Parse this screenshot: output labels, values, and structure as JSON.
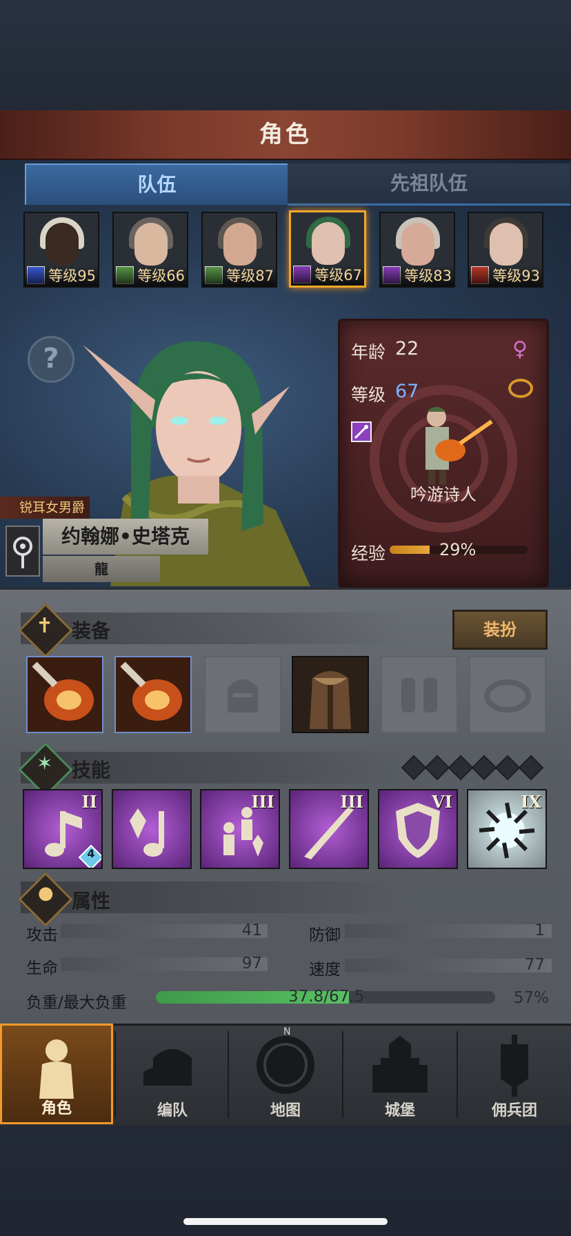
{
  "header": {
    "title": "角色"
  },
  "tabs": [
    {
      "label": "队伍",
      "active": true
    },
    {
      "label": "先祖队伍",
      "active": false
    }
  ],
  "roster": [
    {
      "level_text": "等级95",
      "class_color": "#3b5bdb",
      "skin": "#3a2a22",
      "hair": "#d9d4c8"
    },
    {
      "level_text": "等级66",
      "class_color": "#5a9a4a",
      "skin": "#d9b8a0",
      "hair": "#6a6460"
    },
    {
      "level_text": "等级87",
      "class_color": "#5a9a4a",
      "skin": "#d2a890",
      "hair": "#5e5650"
    },
    {
      "level_text": "等级67",
      "class_color": "#8c3fbf",
      "skin": "#e0c0b0",
      "hair": "#2f6a44",
      "selected": true
    },
    {
      "level_text": "等级83",
      "class_color": "#8c3fbf",
      "skin": "#d6aa98",
      "hair": "#c9c2b8"
    },
    {
      "level_text": "等级93",
      "class_color": "#c23a2a",
      "skin": "#dfc0ae",
      "hair": "#3e3a38"
    }
  ],
  "character": {
    "title": "锐耳女男爵",
    "name": "约翰娜•史塔克",
    "faction": "龍",
    "age_label": "年龄",
    "age": "22",
    "level_label": "等级",
    "level": "67",
    "class_name": "吟游诗人",
    "exp_label": "经验",
    "exp_percent": "29%",
    "exp_fraction": 0.29
  },
  "equipment": {
    "title": "装备",
    "outfit_button": "装扮"
  },
  "skills": {
    "title": "技能",
    "items": [
      {
        "rank": "II",
        "badge": "4"
      },
      {
        "rank": ""
      },
      {
        "rank": "III"
      },
      {
        "rank": "III"
      },
      {
        "rank": "VI"
      },
      {
        "rank": "IX"
      }
    ]
  },
  "attributes": {
    "title": "属性",
    "attack_label": "攻击",
    "attack": "41",
    "defense_label": "防御",
    "defense": "1",
    "hp_label": "生命",
    "hp": "97",
    "speed_label": "速度",
    "speed": "77",
    "load_label": "负重/最大负重",
    "load": "37.8/67.5",
    "load_percent": "57%",
    "load_fraction": 0.57
  },
  "nav": [
    {
      "label": "角色",
      "active": true
    },
    {
      "label": "编队"
    },
    {
      "label": "地图"
    },
    {
      "label": "城堡"
    },
    {
      "label": "佣兵团"
    }
  ]
}
